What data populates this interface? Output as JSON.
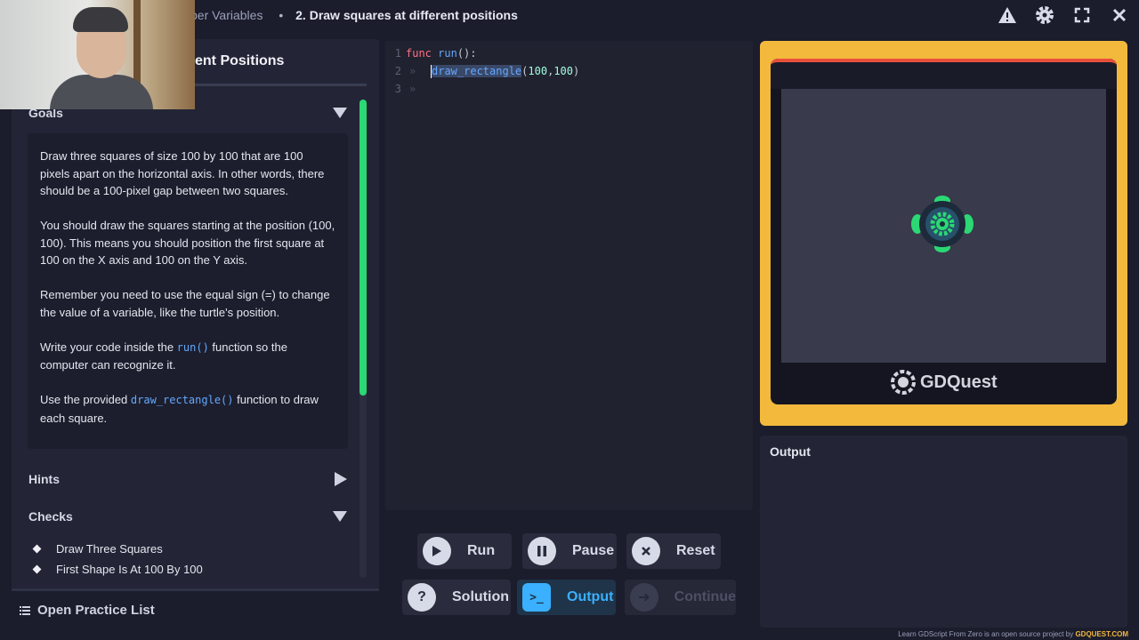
{
  "header": {
    "breadcrumb_prev": "ber Variables",
    "breadcrumb_sep": "•",
    "breadcrumb_current": "2. Draw squares at different positions",
    "icons": [
      "warning-icon",
      "gear-icon",
      "expand-icon",
      "close-icon"
    ]
  },
  "lesson": {
    "title": "ent Positions"
  },
  "goals": {
    "label": "Goals",
    "p1": "Draw three squares of size 100 by 100 that are 100 pixels apart on the horizontal axis. In other words, there should be a 100-pixel gap between two squares.",
    "p2": "You should draw the squares starting at the position (100, 100). This means you should position the first square at 100 on the X axis and 100 on the Y axis.",
    "p3": "Remember you need to use the equal sign (=) to change the value of a variable, like the turtle's position.",
    "p4_pre": "Write your code inside the ",
    "p4_code": "run()",
    "p4_post": " function so the computer can recognize it.",
    "p5_pre": "Use the provided ",
    "p5_code": "draw_rectangle()",
    "p5_post": " function to draw each square."
  },
  "hints": {
    "label": "Hints"
  },
  "checks": {
    "label": "Checks",
    "items": [
      "Draw Three Squares",
      "First Shape Is At 100 By 100"
    ]
  },
  "practice_list": {
    "label": "Open Practice List"
  },
  "code": {
    "line1_num": "1",
    "line1_kw": "func",
    "line1_fn": "run",
    "line1_rest": "():",
    "line2_num": "2",
    "line2_fn": "draw_rectangle",
    "line2_open": "(",
    "line2_a": "100",
    "line2_comma": ", ",
    "line2_b": "100",
    "line2_close": ")",
    "line3_num": "3",
    "tab_glyph": "»"
  },
  "buttons": {
    "run": "Run",
    "pause": "Pause",
    "reset": "Reset",
    "solution": "Solution",
    "output": "Output",
    "continue": "Continue"
  },
  "viewport": {
    "logo_text": "GDQuest"
  },
  "output": {
    "label": "Output"
  },
  "footer": {
    "text": "Learn GDScript From Zero is an open source project by",
    "brand": "GDQUEST.COM"
  },
  "colors": {
    "accent_green": "#2bd873",
    "accent_blue": "#3ab0ff",
    "frame_yellow": "#f2b93d",
    "keyword": "#ff7085",
    "function": "#64a8ff",
    "number": "#a1ffe0"
  }
}
